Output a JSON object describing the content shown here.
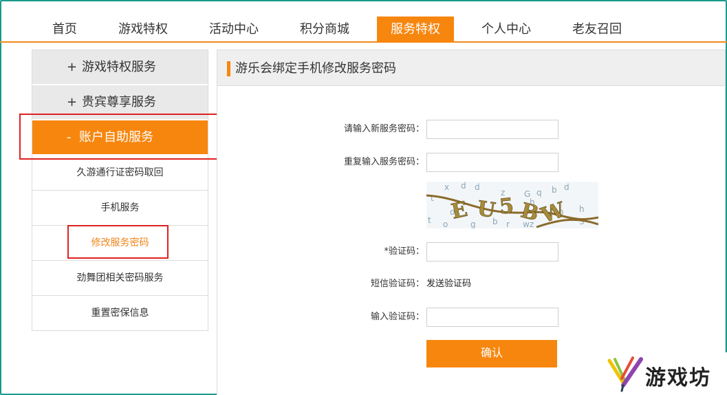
{
  "nav": {
    "items": [
      {
        "label": "首页"
      },
      {
        "label": "游戏特权"
      },
      {
        "label": "活动中心"
      },
      {
        "label": "积分商城"
      },
      {
        "label": "服务特权"
      },
      {
        "label": "个人中心"
      },
      {
        "label": "老友召回"
      }
    ],
    "active_index": 4
  },
  "sidebar": {
    "groups": [
      {
        "mark": "+",
        "label": "游戏特权服务",
        "expanded": false
      },
      {
        "mark": "+",
        "label": "贵宾尊享服务",
        "expanded": false
      },
      {
        "mark": "-",
        "label": "账户自助服务",
        "expanded": true
      }
    ],
    "sub_items": [
      {
        "label": "久游通行证密码取回"
      },
      {
        "label": "手机服务"
      },
      {
        "label": "修改服务密码"
      },
      {
        "label": "劲舞团相关密码服务"
      },
      {
        "label": "重置密保信息"
      }
    ],
    "active_sub_index": 2
  },
  "content": {
    "title": "游乐会绑定手机修改服务密码",
    "form": {
      "new_password_label": "请输入新服务密码：",
      "new_password_value": "",
      "repeat_password_label": "重复输入服务密码：",
      "repeat_password_value": "",
      "captcha_text": "EU5BW",
      "captcha_label": "*验证码：",
      "captcha_value": "",
      "sms_label": "短信验证码：",
      "sms_link": "发送验证码",
      "sms_code_label": "输入验证码：",
      "sms_code_value": "",
      "confirm_label": "确认"
    }
  },
  "watermark": {
    "text": "游戏坊"
  },
  "colors": {
    "accent": "#f7860f",
    "highlight_box": "#e02020",
    "frame": "#1a9a8c"
  }
}
